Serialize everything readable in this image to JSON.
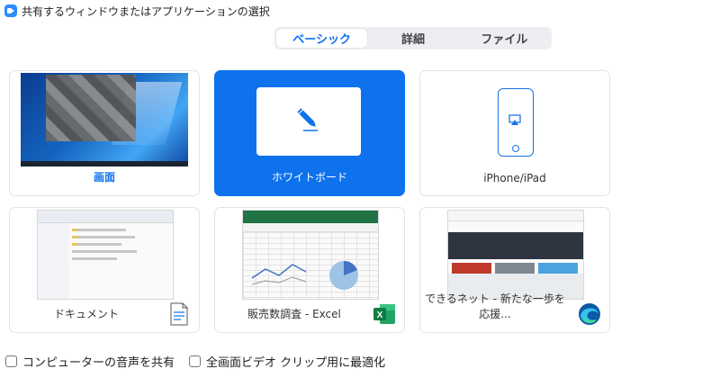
{
  "window": {
    "title": "共有するウィンドウまたはアプリケーションの選択"
  },
  "tabs": [
    {
      "label": "ベーシック",
      "active": true
    },
    {
      "label": "詳細",
      "active": false
    },
    {
      "label": "ファイル",
      "active": false
    }
  ],
  "tiles": [
    {
      "label": "画面",
      "icon": "screen-thumbnail",
      "selected": false
    },
    {
      "label": "ホワイトボード",
      "icon": "pencil-icon",
      "selected": true
    },
    {
      "label": "iPhone/iPad",
      "icon": "iphone-airplay-icon",
      "selected": false
    },
    {
      "label": "ドキュメント",
      "icon": "document-icon",
      "selected": false
    },
    {
      "label": "販売数調査 - Excel",
      "icon": "excel-icon",
      "selected": false
    },
    {
      "label": "できるネット - 新たな一歩を応援...",
      "icon": "edge-icon",
      "selected": false
    }
  ],
  "options": [
    {
      "label": "コンピューターの音声を共有",
      "checked": false
    },
    {
      "label": "全画面ビデオ クリップ用に最適化",
      "checked": false
    }
  ],
  "colors": {
    "accent": "#0e72ed",
    "tile_border": "#e1e3e8",
    "tab_bg": "#edeef2"
  }
}
